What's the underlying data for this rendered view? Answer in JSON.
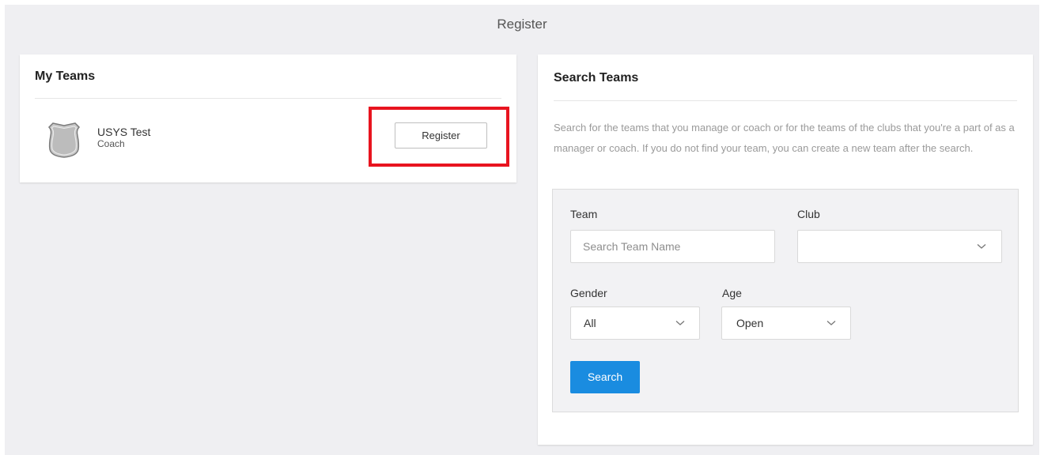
{
  "page": {
    "title": "Register"
  },
  "my_teams": {
    "heading": "My Teams",
    "team": {
      "name": "USYS Test",
      "role": "Coach",
      "icon": "shield-icon",
      "register_label": "Register"
    },
    "highlight_color": "#e8141f"
  },
  "search_teams": {
    "heading": "Search Teams",
    "description": "Search for the teams that you manage or coach or for the teams of the clubs that you're a part of as a manager or coach. If you do not find your team, you can create a new team after the search.",
    "form": {
      "team_label": "Team",
      "team_placeholder": "Search Team Name",
      "team_value": "",
      "club_label": "Club",
      "club_value": "",
      "gender_label": "Gender",
      "gender_value": "All",
      "age_label": "Age",
      "age_value": "Open",
      "search_label": "Search"
    },
    "accent_color": "#1a8ce0"
  }
}
